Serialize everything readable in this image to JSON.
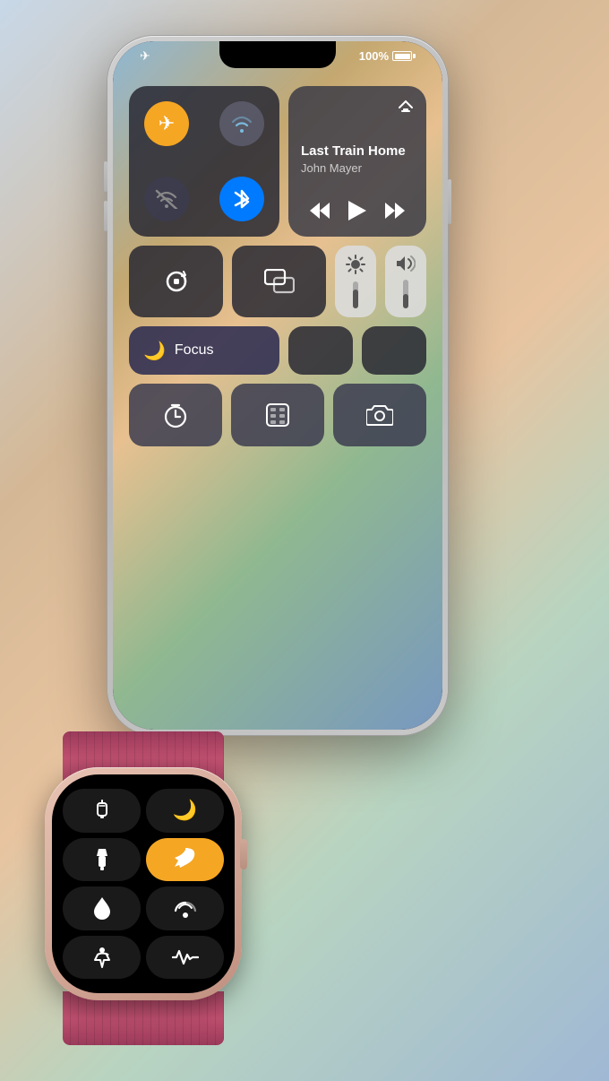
{
  "status_bar": {
    "battery_label": "100%",
    "airplane_icon": "✈"
  },
  "media": {
    "title": "Last Train Home",
    "artist": "John Mayer",
    "airplay_icon": "⊙",
    "prev_icon": "«",
    "play_icon": "▶",
    "next_icon": "»"
  },
  "focus": {
    "label": "Focus",
    "moon_icon": "🌙"
  },
  "iphone_tiles": {
    "rotation_lock_icon": "⊙",
    "mirror_icon": "⧉",
    "timer_icon": "⏱",
    "calculator_icon": "⊞",
    "camera_icon": "⊙"
  },
  "watch": {
    "walkie_icon": "⊙",
    "moon_icon": "🌙",
    "flashlight_icon": "🔦",
    "airplane_icon": "✈",
    "water_icon": "💧",
    "airplay_icon": "⊙",
    "accessibility_icon": "⊙",
    "activity_icon": "〜"
  }
}
